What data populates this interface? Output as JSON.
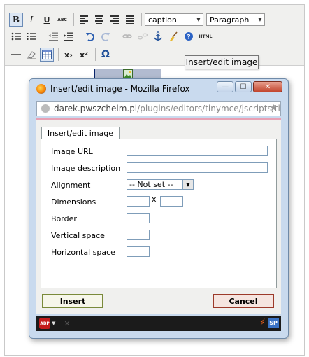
{
  "toolbar": {
    "bold_label": "B",
    "italic_label": "I",
    "underline_label": "U",
    "strike_label": "ABC",
    "style_select": {
      "value": "caption"
    },
    "format_select": {
      "value": "Paragraph"
    },
    "html_label": "HTML",
    "subscript_label": "x₂",
    "superscript_label": "x²",
    "omega_label": "Ω",
    "tooltip": "Insert/edit image"
  },
  "browser_window": {
    "title": "Insert/edit image - Mozilla Firefox",
    "url_domain": "darek.pwszchelm.pl",
    "url_path": "/plugins/editors/tinymce/jscripts/tin",
    "min_label": "—",
    "max_label": "☐",
    "close_label": "✕"
  },
  "dialog": {
    "tab_label": "Insert/edit image",
    "fields": {
      "image_url": {
        "label": "Image URL",
        "value": ""
      },
      "image_description": {
        "label": "Image description",
        "value": ""
      },
      "alignment": {
        "label": "Alignment",
        "value": "-- Not set --"
      },
      "dimensions": {
        "label": "Dimensions",
        "width": "",
        "height": "",
        "separator": "x"
      },
      "border": {
        "label": "Border",
        "value": ""
      },
      "vertical_space": {
        "label": "Vertical space",
        "value": ""
      },
      "horizontal_space": {
        "label": "Horizontal space",
        "value": ""
      }
    },
    "insert_label": "Insert",
    "cancel_label": "Cancel"
  },
  "statusbar": {
    "abp_label": "ABP",
    "sp_label": "SP"
  }
}
